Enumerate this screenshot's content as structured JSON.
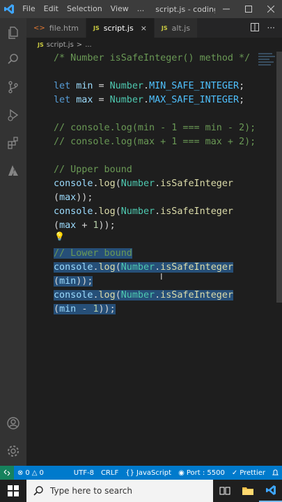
{
  "titlebar": {
    "menus": [
      "File",
      "Edit",
      "Selection",
      "View"
    ],
    "more": "...",
    "title": "script.js - coding - ..."
  },
  "tabs": [
    {
      "label": "file.htm",
      "badge": ""
    },
    {
      "label": "script.js",
      "badge": "JS",
      "active": true
    },
    {
      "label": "alt.js",
      "badge": "JS"
    }
  ],
  "breadcrumb": {
    "badge": "JS",
    "file": "script.js",
    "sep": ">",
    "rest": "..."
  },
  "editor": {
    "lines": [
      "/* Number isSafeInteger() method */",
      "",
      "let min = Number.MIN_SAFE_INTEGER;",
      "let max = Number.MAX_SAFE_INTEGER;",
      "",
      "// console.log(min - 1 === min - 2);",
      "// console.log(max + 1 === max + 2);",
      "",
      "// Upper bound",
      "console.log(Number.isSafeInteger",
      "(max));",
      "console.log(Number.isSafeInteger",
      "(max + 1));",
      "",
      "// Lower bound",
      "console.log(Number.isSafeInteger",
      "(min));",
      "console.log(Number.isSafeInteger",
      "(min - 1));"
    ]
  },
  "statusbar": {
    "errors": "0",
    "warnings": "0",
    "encoding": "UTF-8",
    "eol": "CRLF",
    "language": "JavaScript",
    "port": "Port : 5500",
    "prettier": "Prettier"
  },
  "taskbar": {
    "search_placeholder": "Type here to search"
  },
  "colors": {
    "statusbar": "#007acc",
    "selection": "#264f78",
    "activitybar": "#333333"
  }
}
